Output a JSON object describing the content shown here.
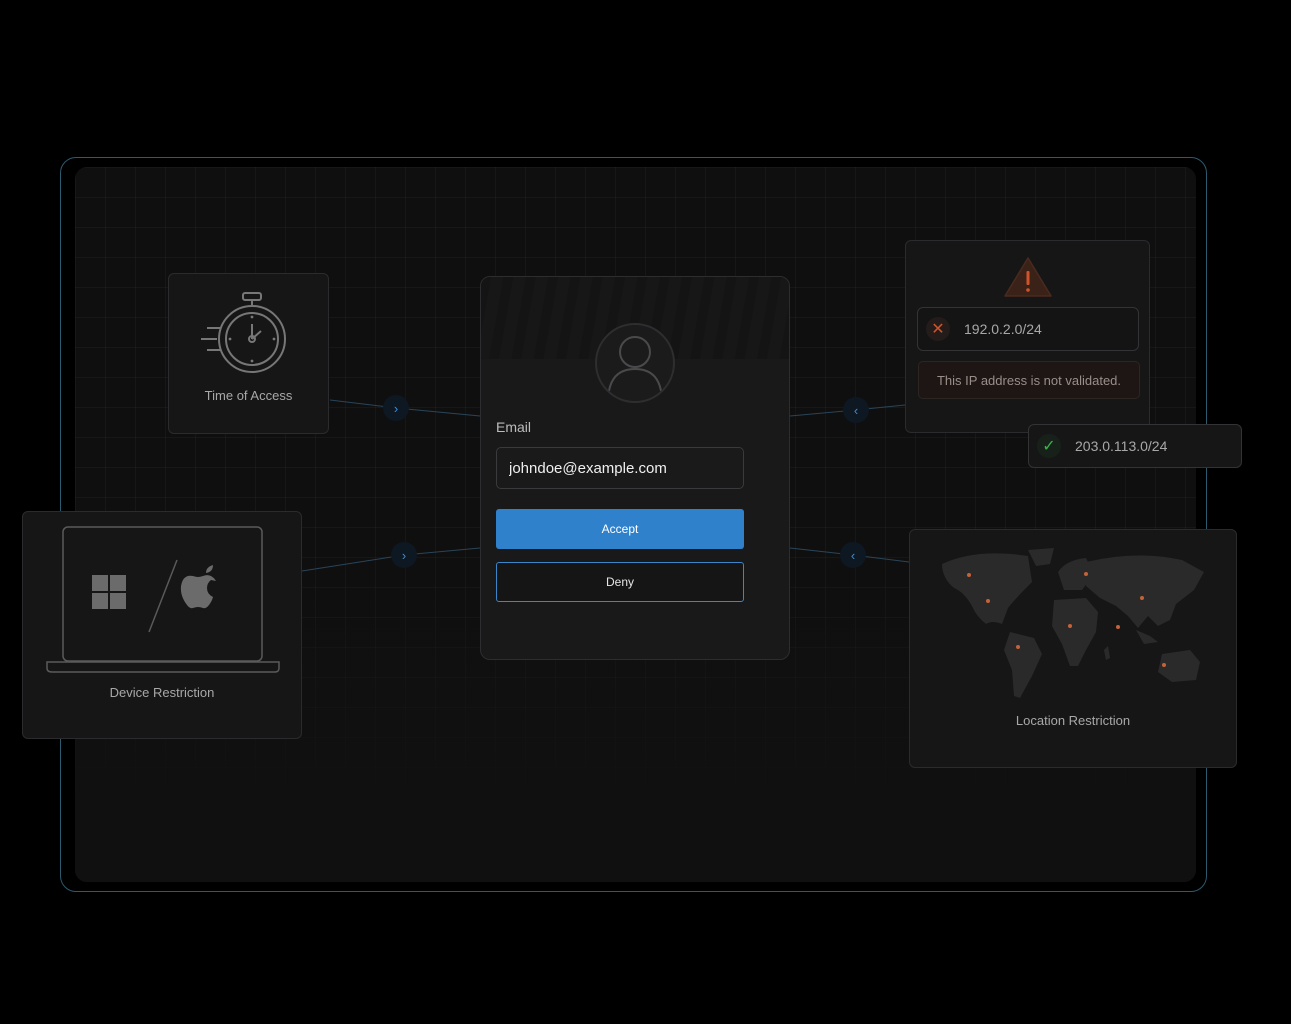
{
  "time_card": {
    "caption": "Time of Access",
    "icon": "stopwatch-icon"
  },
  "device_card": {
    "caption": "Device Restriction",
    "icons": [
      "windows-logo-icon",
      "apple-logo-icon"
    ]
  },
  "login": {
    "email_label": "Email",
    "email_value": "johndoe@example.com",
    "accept_label": "Accept",
    "deny_label": "Deny",
    "accent_color": "#3081cc"
  },
  "ip_card": {
    "blocked_ip": "192.0.2.0/24",
    "warning_text": "This IP address is not validated.",
    "allowed_ip": "203.0.113.0/24",
    "warning_color": "#c2522a",
    "ok_color": "#36b44a"
  },
  "location_card": {
    "caption": "Location Restriction",
    "marker_color": "#c5623a"
  }
}
